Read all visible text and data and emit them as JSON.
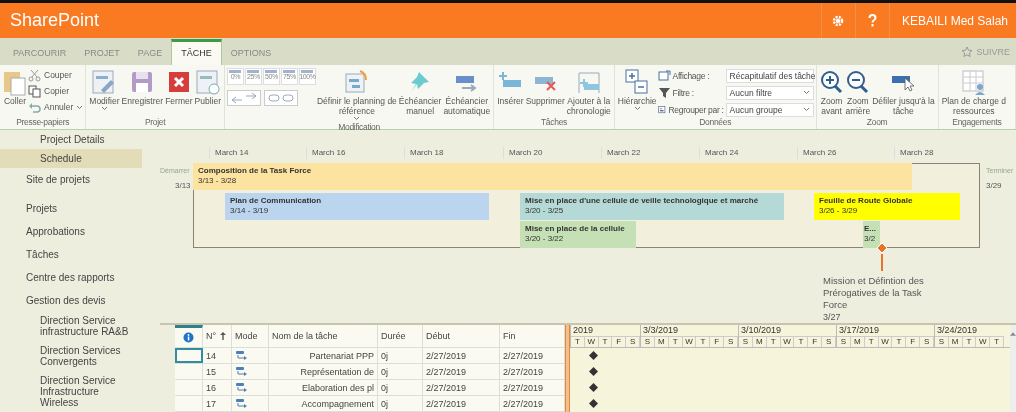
{
  "header": {
    "title": "SharePoint",
    "user": "KEBAILI Med Salah"
  },
  "tabs": [
    {
      "label": "PARCOURIR",
      "selected": false
    },
    {
      "label": "PROJET",
      "selected": false
    },
    {
      "label": "PAGE",
      "selected": false
    },
    {
      "label": "TÂCHE",
      "selected": true
    },
    {
      "label": "OPTIONS",
      "selected": false
    }
  ],
  "follow": "SUIVRE",
  "ribbon": [
    {
      "label": "Presse-papiers",
      "items": [
        {
          "kind": "large",
          "lines": [
            "Coller"
          ]
        },
        {
          "kind": "stack",
          "items": [
            {
              "kind": "small",
              "label": "Couper"
            },
            {
              "kind": "small",
              "label": "Copier"
            },
            {
              "kind": "small",
              "label": "Annuler",
              "menu": true
            }
          ]
        }
      ]
    },
    {
      "label": "Projet",
      "items": [
        {
          "kind": "large",
          "lines": [
            "Modifier"
          ],
          "menu": true
        },
        {
          "kind": "large",
          "lines": [
            "Enregistrer"
          ]
        },
        {
          "kind": "large",
          "lines": [
            "Fermer"
          ]
        },
        {
          "kind": "large",
          "lines": [
            "Publier"
          ]
        }
      ]
    },
    {
      "label": "Modification",
      "items": [
        {
          "kind": "stack",
          "items": [
            {
              "kind": "percents",
              "labels": [
                "0%",
                "25%",
                "50%",
                "75%",
                "100%"
              ]
            },
            {
              "kind": "links"
            }
          ]
        },
        {
          "kind": "large",
          "lines": [
            "Définir le planning de",
            "référence"
          ],
          "menu": true
        },
        {
          "kind": "large",
          "lines": [
            "Échéancier",
            "manuel"
          ]
        },
        {
          "kind": "large",
          "lines": [
            "Échéancier",
            "automatique"
          ]
        }
      ]
    },
    {
      "label": "Tâches",
      "items": [
        {
          "kind": "large",
          "lines": [
            "Insérer"
          ]
        },
        {
          "kind": "large",
          "lines": [
            "Supprimer"
          ]
        },
        {
          "kind": "large",
          "lines": [
            "Ajouter à la",
            "chronologie"
          ]
        }
      ]
    },
    {
      "label": "Données",
      "items": [
        {
          "kind": "large",
          "lines": [
            "Hiérarchie"
          ],
          "menu": true
        },
        {
          "kind": "stack",
          "items": [
            {
              "kind": "field",
              "label": "Affichage :",
              "value": "Récapitulatif des tâche"
            },
            {
              "kind": "field",
              "label": "Filtre :",
              "value": "Aucun filtre"
            },
            {
              "kind": "field",
              "label": "Regrouper par :",
              "value": "Aucun groupe"
            }
          ]
        }
      ]
    },
    {
      "label": "Zoom",
      "items": [
        {
          "kind": "large",
          "lines": [
            "Zoom",
            "avant"
          ]
        },
        {
          "kind": "large",
          "lines": [
            "Zoom",
            "arrière"
          ]
        },
        {
          "kind": "large",
          "lines": [
            "Défiler jusqu'à la",
            "tâche"
          ]
        }
      ]
    },
    {
      "label": "Engagements",
      "items": [
        {
          "kind": "large",
          "lines": [
            "Plan de charge d",
            "ressources"
          ]
        }
      ]
    }
  ],
  "nav": {
    "sub_items": [
      {
        "label": "Project Details",
        "selected": false
      },
      {
        "label": "Schedule",
        "selected": true
      }
    ],
    "site": "Site de projets",
    "items": [
      {
        "label": "Projets"
      },
      {
        "label": "Approbations"
      },
      {
        "label": "Tâches"
      },
      {
        "label": "Centre des rapports"
      },
      {
        "label": "Gestion des devis",
        "children": [
          {
            "label": "Direction Service infrastructure RA&B"
          },
          {
            "label": "Direction Services Convergents"
          },
          {
            "label": "Direction Service Infrastructure Wireless"
          }
        ]
      }
    ]
  },
  "timeline": {
    "start_label": "Démarrer",
    "start_date": "3/13",
    "end_label": "Terminer",
    "end_date": "3/29",
    "dates": [
      "March 14",
      "March 16",
      "March 18",
      "March 20",
      "March 22",
      "March 24",
      "March 26",
      "March 28"
    ],
    "tasks": [
      {
        "name": "Composition de la Task Force",
        "dates": "3/13 - 3/28",
        "color": "#fde3a0"
      },
      {
        "name": "Plan de Communication",
        "dates": "3/14 - 3/19",
        "color": "#bcd5ef"
      },
      {
        "name": "Mise en place d'une cellule de veille technologique et marché",
        "dates": "3/20 - 3/25",
        "color": "#b5d9d6"
      },
      {
        "name": "Feuille de Route Globale",
        "dates": "3/26 - 3/29",
        "color": "#ffff00"
      },
      {
        "name": "Mise en place de la cellule",
        "dates": "3/20 - 3/22",
        "color": "#c6e0b6"
      },
      {
        "name": "E...",
        "dates": "3/2",
        "color": "#c6e0b6"
      }
    ],
    "milestone": {
      "name": "Mission et Défintion des Prérogatives de la Task Force",
      "date": "3/27"
    }
  },
  "grid": {
    "columns": [
      {
        "label": "N°",
        "sorted": true
      },
      {
        "label": "Mode"
      },
      {
        "label": "Nom de la tâche"
      },
      {
        "label": "Durée"
      },
      {
        "label": "Début"
      },
      {
        "label": "Fin"
      }
    ],
    "rows": [
      {
        "number": "14",
        "name": "Partenariat PPP",
        "duration": "0j",
        "start": "2/27/2019",
        "end": "2/27/2019",
        "selected": true
      },
      {
        "number": "15",
        "name": "Représentation de",
        "duration": "0j",
        "start": "2/27/2019",
        "end": "2/27/2019",
        "selected": false
      },
      {
        "number": "16",
        "name": "Elaboration des pl",
        "duration": "0j",
        "start": "2/27/2019",
        "end": "2/27/2019",
        "selected": false
      },
      {
        "number": "17",
        "name": "Accompagnement",
        "duration": "0j",
        "start": "2/27/2019",
        "end": "2/27/2019",
        "selected": false
      }
    ],
    "weeks": [
      {
        "label": "2019",
        "days": [
          "T",
          "W",
          "T",
          "F",
          "S"
        ]
      },
      {
        "label": "3/3/2019",
        "days": [
          "S",
          "M",
          "T",
          "W",
          "T",
          "F",
          "S"
        ]
      },
      {
        "label": "3/10/2019",
        "days": [
          "S",
          "M",
          "T",
          "W",
          "T",
          "F",
          "S"
        ]
      },
      {
        "label": "3/17/2019",
        "days": [
          "S",
          "M",
          "T",
          "W",
          "T",
          "F",
          "S"
        ]
      },
      {
        "label": "3/24/2019",
        "days": [
          "S",
          "M",
          "T",
          "W",
          "T"
        ]
      }
    ]
  }
}
